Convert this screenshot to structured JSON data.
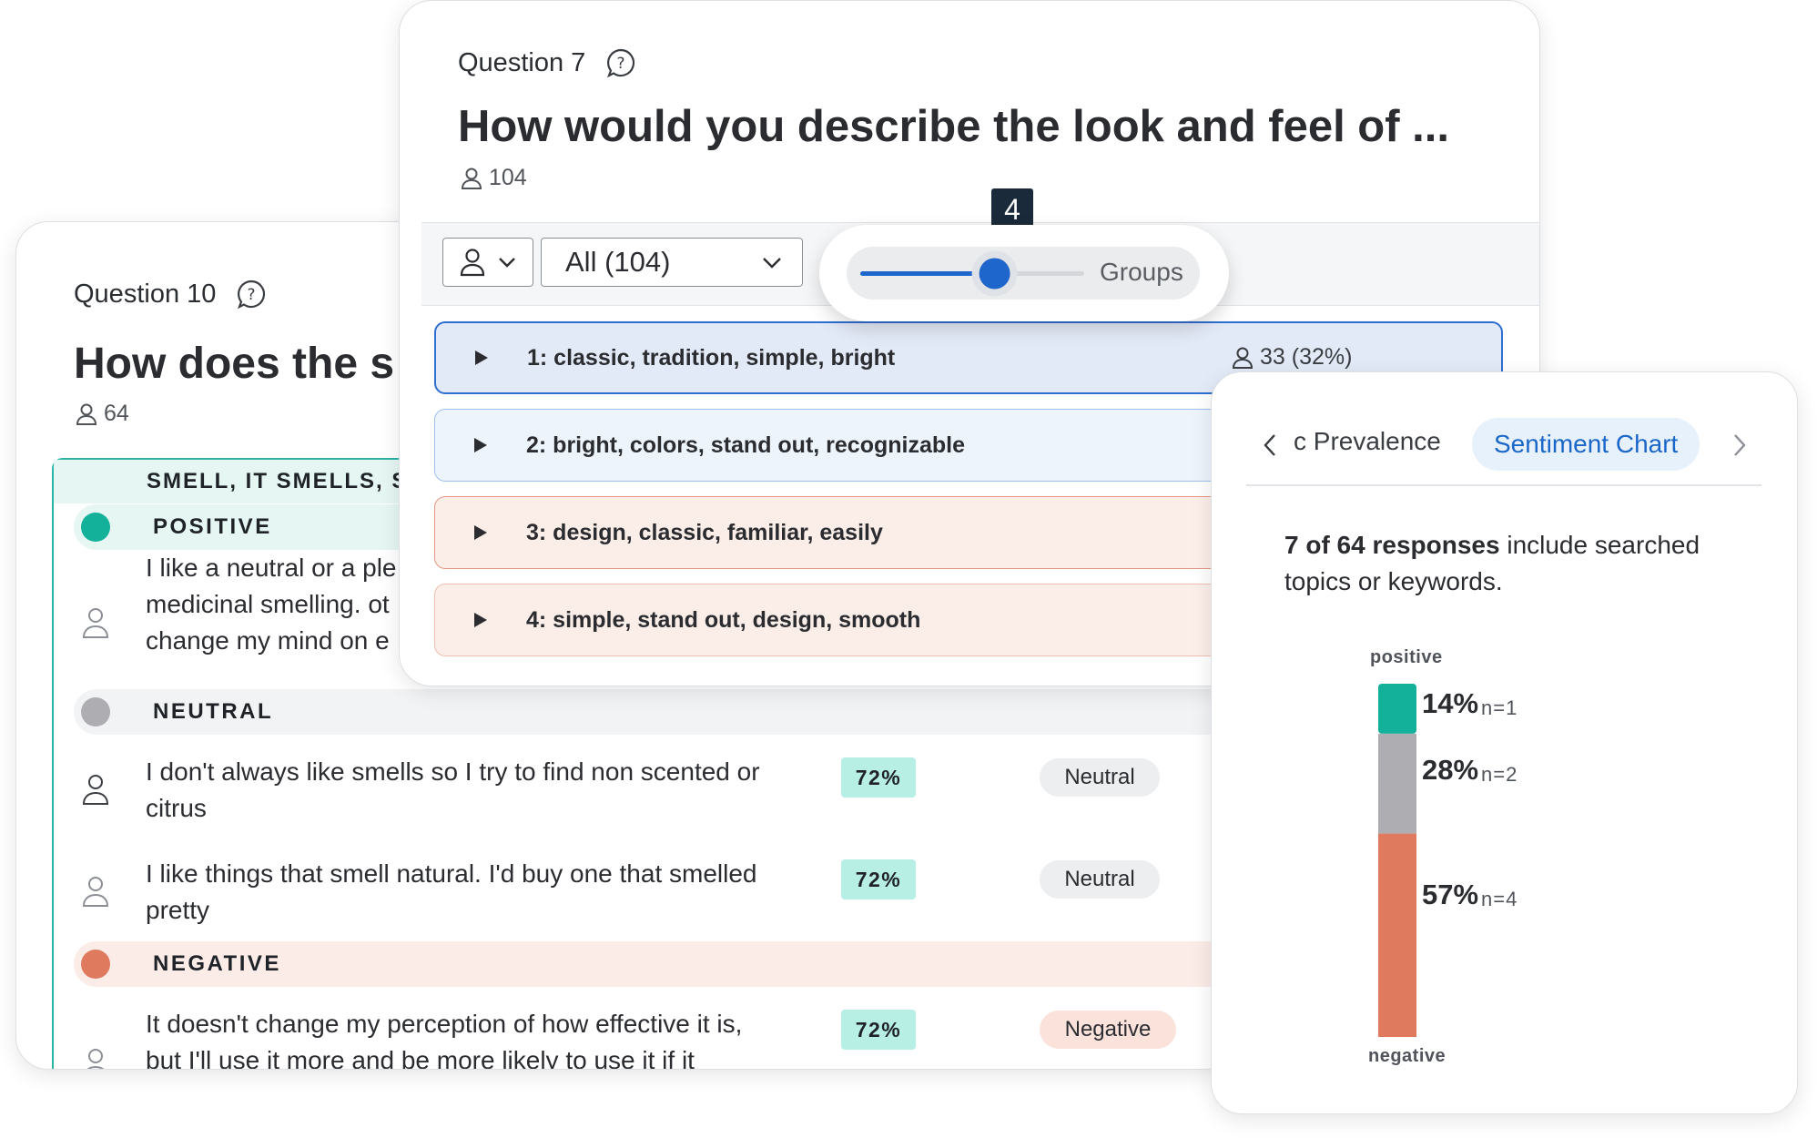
{
  "question10": {
    "label": "Question 10",
    "title": "How does the s",
    "respondents": "64",
    "topic_header": "SMELL, IT SMELLS, SI",
    "sentiments": [
      {
        "label": "POSITIVE",
        "color": "#13b09a"
      },
      {
        "label": "NEUTRAL",
        "color": "#aeaeb2"
      },
      {
        "label": "NEGATIVE",
        "color": "#e07a5f"
      }
    ],
    "responses": [
      {
        "lines": [
          "I like a neutral or a ple",
          "medicinal smelling. ot",
          "change my mind on e"
        ],
        "percent": "",
        "sentiment": ""
      },
      {
        "lines": [
          "I don't always like smells so I try to find non scented or",
          "citrus"
        ],
        "percent": "72%",
        "sentiment": "Neutral"
      },
      {
        "lines": [
          "I like things that smell natural. I'd buy one that smelled",
          "pretty"
        ],
        "percent": "72%",
        "sentiment": "Neutral"
      },
      {
        "lines": [
          "It doesn't change my perception of how effective it is,",
          "but I'll use it more and be more likely to use it if it"
        ],
        "percent": "72%",
        "sentiment": "Negative"
      }
    ]
  },
  "question7": {
    "label": "Question 7",
    "title": "How would you describe the look and feel of ...",
    "respondents": "104",
    "filter_value": "All (104)",
    "slider": {
      "value": "4",
      "label": "Groups",
      "fraction": 0.6
    },
    "groups": [
      {
        "label": "1: classic, tradition, simple, bright",
        "count": "33 (32%)"
      },
      {
        "label": "2: bright, colors, stand out, recognizable"
      },
      {
        "label": "3: design, classic, familiar, easily"
      },
      {
        "label": "4: simple, stand out, design, smooth"
      }
    ]
  },
  "sentiment_panel": {
    "tab_previous": "c Prevalence",
    "tab_active": "Sentiment Chart",
    "summary_bold": "7 of 64 responses",
    "summary_rest": " include searched topics or keywords.",
    "axis_top": "positive",
    "axis_bottom": "negative"
  },
  "chart_data": {
    "type": "bar",
    "stacked": true,
    "orientation": "vertical",
    "categories": [
      "positive",
      "neutral",
      "negative"
    ],
    "series": [
      {
        "name": "positive",
        "percent": "14%",
        "n": "n=1",
        "value": 14,
        "color": "#13b09a"
      },
      {
        "name": "neutral",
        "percent": "28%",
        "n": "n=2",
        "value": 28,
        "color": "#aeaeb2"
      },
      {
        "name": "negative",
        "percent": "57%",
        "n": "n=4",
        "value": 57,
        "color": "#e07a5f"
      }
    ]
  }
}
